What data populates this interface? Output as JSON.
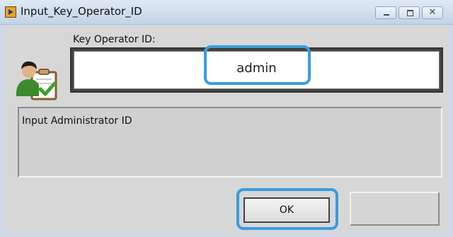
{
  "window": {
    "title": "Input_Key_Operator_ID",
    "controls": [
      "minimize",
      "maximize",
      "close"
    ]
  },
  "form": {
    "field_label": "Key Operator ID:",
    "field_value": "admin",
    "message": "Input Administrator ID",
    "ok_label": "OK",
    "blank_button_label": ""
  },
  "icons": {
    "app": "labview-vi-icon",
    "user": "user-clipboard-check-icon"
  },
  "colors": {
    "highlight": "#3a9be0"
  }
}
